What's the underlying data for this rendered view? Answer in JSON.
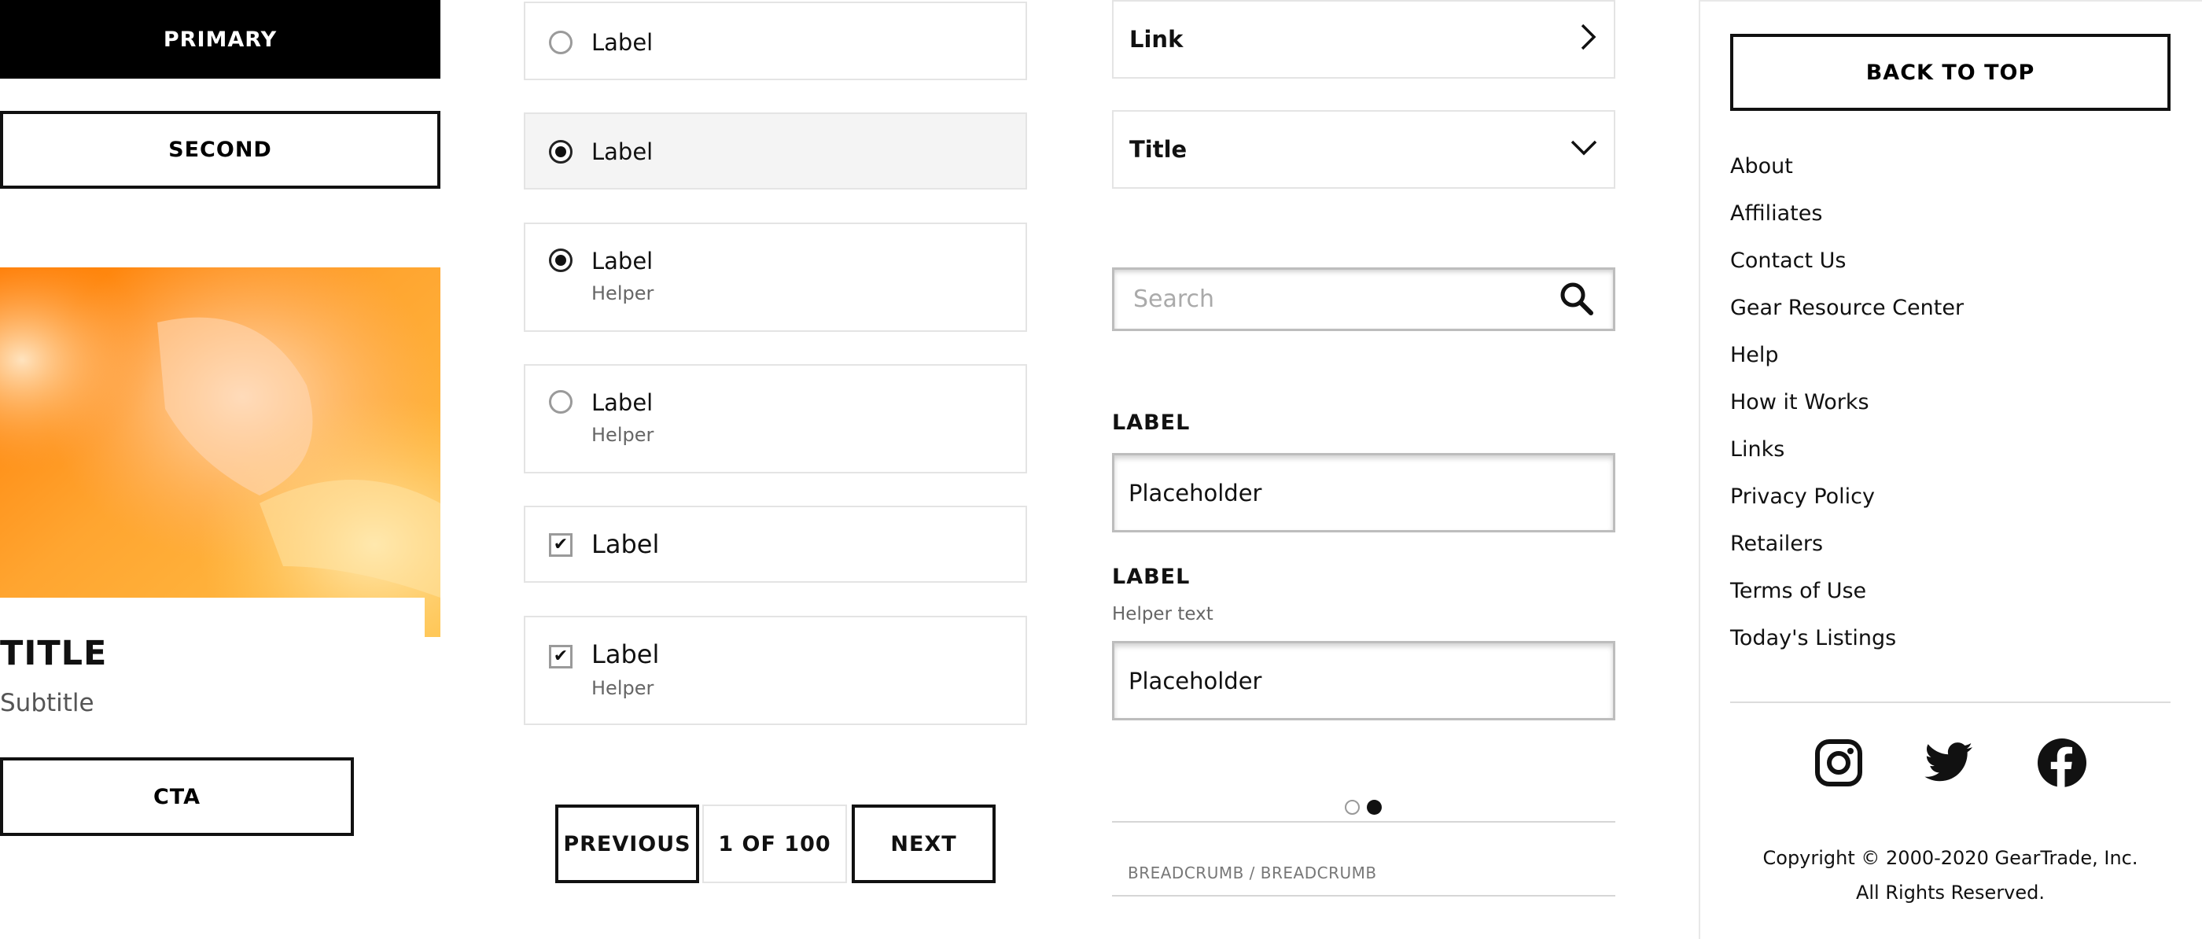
{
  "buttons": {
    "primary": "PRIMARY",
    "second": "SECOND",
    "cta": "CTA"
  },
  "card": {
    "title": "TITLE",
    "subtitle": "Subtitle"
  },
  "options": [
    {
      "type": "radio",
      "label": "Label",
      "helper": "",
      "checked": false,
      "highlighted": false
    },
    {
      "type": "radio",
      "label": "Label",
      "helper": "",
      "checked": true,
      "highlighted": true
    },
    {
      "type": "radio",
      "label": "Label",
      "helper": "Helper",
      "checked": true,
      "highlighted": false
    },
    {
      "type": "radio",
      "label": "Label",
      "helper": "Helper",
      "checked": false,
      "highlighted": false
    },
    {
      "type": "checkbox",
      "label": "Label",
      "helper": "",
      "checked": true,
      "highlighted": false
    },
    {
      "type": "checkbox",
      "label": "Label",
      "helper": "Helper",
      "checked": true,
      "highlighted": false
    }
  ],
  "pagination": {
    "previous": "PREVIOUS",
    "current": "1 OF 100",
    "next": "NEXT"
  },
  "link_row": {
    "label": "Link",
    "icon": "chevron-right-icon"
  },
  "accordion": {
    "title": "Title",
    "icon": "chevron-down-icon"
  },
  "search": {
    "placeholder": "Search",
    "icon": "search-icon"
  },
  "fields": [
    {
      "label": "LABEL",
      "helper": "",
      "placeholder": "Placeholder"
    },
    {
      "label": "LABEL",
      "helper": "Helper text",
      "placeholder": "Placeholder"
    }
  ],
  "carousel": {
    "total": 2,
    "active": 2
  },
  "breadcrumb": "BREADCRUMB / BREADCRUMB",
  "footer": {
    "back_to_top": "BACK TO TOP",
    "links": [
      "About",
      "Affiliates",
      "Contact Us",
      "Gear Resource Center",
      "Help",
      "How it Works",
      "Links",
      "Privacy Policy",
      "Retailers",
      "Terms of Use",
      "Today's Listings"
    ],
    "social": [
      "instagram-icon",
      "twitter-icon",
      "facebook-icon"
    ],
    "copyright_line1": "Copyright © 2000-2020 GearTrade, Inc.",
    "copyright_line2": "All Rights Reserved."
  },
  "colors": {
    "primary": "#000000",
    "border": "#e4e4e4",
    "selected_bg": "#f4f4f4",
    "hero_orange": "#ff9a1a"
  }
}
